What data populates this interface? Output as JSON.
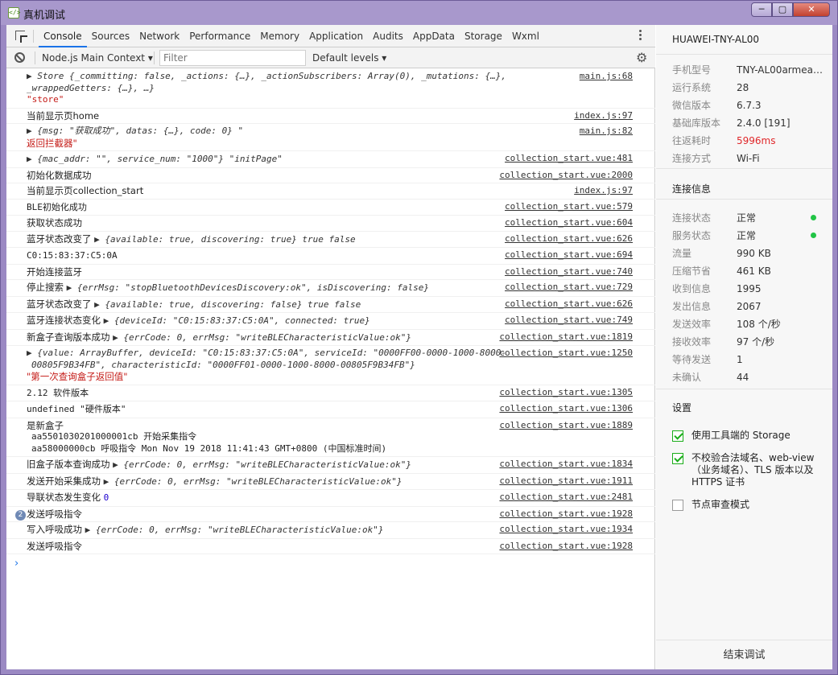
{
  "window": {
    "title": "真机调试",
    "app_icon": "</>",
    "minimize": "─",
    "maximize": "▢",
    "close": "✕"
  },
  "devtools": {
    "tabs": [
      {
        "label": "Console",
        "active": true
      },
      {
        "label": "Sources"
      },
      {
        "label": "Network"
      },
      {
        "label": "Performance"
      },
      {
        "label": "Memory"
      },
      {
        "label": "Application"
      },
      {
        "label": "Audits"
      },
      {
        "label": "AppData"
      },
      {
        "label": "Storage"
      },
      {
        "label": "Wxml"
      }
    ],
    "toolbar": {
      "context": "Node.js Main Context",
      "filter_placeholder": "Filter",
      "levels": "Default levels"
    }
  },
  "console": {
    "rows": [
      {
        "src": "main.js:68",
        "line1": "▶ Store {_committing: false, _actions: {…}, _actionSubscribers: Array(0), _mutations: {…}, _wrappedGetters: {…}, …}",
        "line2": "\"store\""
      },
      {
        "src": "index.js:97",
        "text": "当前显示页home"
      },
      {
        "src": "main.js:82",
        "line1": "▶ {msg: \"获取成功\", datas: {…}, code: 0} \"",
        "line2": "返回拦截器\""
      },
      {
        "src": "collection_start.vue:481",
        "text": "▶ {mac_addr: \"\", service_num: \"1000\"} \"initPage\""
      },
      {
        "src": "collection_start.vue:2000",
        "text": "初始化数据成功"
      },
      {
        "src": "index.js:97",
        "text": "当前显示页collection_start"
      },
      {
        "src": "collection_start.vue:579",
        "text": "BLE初始化成功"
      },
      {
        "src": "collection_start.vue:604",
        "text": "获取状态成功"
      },
      {
        "src": "collection_start.vue:626",
        "prefix": "蓝牙状态改变了 ",
        "text": "▶ {available: true, discovering: true} true false"
      },
      {
        "src": "collection_start.vue:694",
        "text": "C0:15:83:37:C5:0A"
      },
      {
        "src": "collection_start.vue:740",
        "text": "开始连接蓝牙"
      },
      {
        "src": "collection_start.vue:729",
        "prefix": "停止搜索 ",
        "text": "▶ {errMsg: \"stopBluetoothDevicesDiscovery:ok\", isDiscovering: false}"
      },
      {
        "src": "collection_start.vue:626",
        "prefix": "蓝牙状态改变了 ",
        "text": "▶ {available: true, discovering: false} true false"
      },
      {
        "src": "collection_start.vue:749",
        "prefix": "蓝牙连接状态变化 ",
        "text": "▶ {deviceId: \"C0:15:83:37:C5:0A\", connected: true}"
      },
      {
        "src": "collection_start.vue:1819",
        "prefix": "新盒子查询版本成功 ",
        "text": "▶ {errCode: 0, errMsg: \"writeBLECharacteristicValue:ok\"}"
      },
      {
        "src": "collection_start.vue:1250",
        "line1": "▶ {value: ArrayBuffer, deviceId: \"C0:15:83:37:C5:0A\", serviceId: \"0000FF00-0000-1000-8000-",
        "line2": "00805F9B34FB\", characteristicId: \"0000FF01-0000-1000-8000-00805F9B34FB\"}",
        "line3": "\"第一次查询盒子返回值\""
      },
      {
        "src": "collection_start.vue:1305",
        "text": "2.12 软件版本"
      },
      {
        "src": "collection_start.vue:1306",
        "text": "undefined \"硬件版本\""
      },
      {
        "src": "collection_start.vue:1889",
        "line1": "是新盒子",
        "line2": "aa5501030201000001cb 开始采集指令",
        "line3": "aa58000000cb 呼吸指令 Mon Nov 19 2018 11:41:43 GMT+0800 (中国标准时间)"
      },
      {
        "src": "collection_start.vue:1834",
        "prefix": "旧盒子版本查询成功 ",
        "text": "▶ {errCode: 0, errMsg: \"writeBLECharacteristicValue:ok\"}"
      },
      {
        "src": "collection_start.vue:1911",
        "prefix": "发送开始采集成功 ",
        "text": "▶ {errCode: 0, errMsg: \"writeBLECharacteristicValue:ok\"}"
      },
      {
        "src": "collection_start.vue:2481",
        "prefix": "导联状态发生变化 ",
        "text": "0"
      },
      {
        "src": "collection_start.vue:1928",
        "badge": "2",
        "text": "发送呼吸指令"
      },
      {
        "src": "collection_start.vue:1934",
        "prefix": "写入呼吸成功 ",
        "text": "▶ {errCode: 0, errMsg: \"writeBLECharacteristicValue:ok\"}"
      },
      {
        "src": "collection_start.vue:1928",
        "text": "发送呼吸指令"
      }
    ],
    "prompt": "›"
  },
  "panel": {
    "device_name": "HUAWEI-TNY-AL00",
    "device_info": [
      {
        "label": "手机型号",
        "value": "TNY-AL00armea…"
      },
      {
        "label": "运行系统",
        "value": "28"
      },
      {
        "label": "微信版本",
        "value": "6.7.3"
      },
      {
        "label": "基础库版本",
        "value": "2.4.0 [191]"
      },
      {
        "label": "往返耗时",
        "value": "5996ms",
        "highlight_color": "#e0272a"
      },
      {
        "label": "连接方式",
        "value": "Wi-Fi"
      }
    ],
    "connection_title": "连接信息",
    "connection_info": [
      {
        "label": "连接状态",
        "value": "正常",
        "status_color": "#21c445"
      },
      {
        "label": "服务状态",
        "value": "正常",
        "status_color": "#21c445"
      },
      {
        "label": "流量",
        "value": "990 KB"
      },
      {
        "label": "压缩节省",
        "value": "461 KB"
      },
      {
        "label": "收到信息",
        "value": "1995"
      },
      {
        "label": "发出信息",
        "value": "2067"
      },
      {
        "label": "发送效率",
        "value": "108 个/秒"
      },
      {
        "label": "接收效率",
        "value": "97 个/秒"
      },
      {
        "label": "等待发送",
        "value": "1"
      },
      {
        "label": "未确认",
        "value": "44"
      }
    ],
    "settings_title": "设置",
    "settings": [
      {
        "label": "使用工具端的 Storage",
        "checked": true
      },
      {
        "label": "不校验合法域名、web-view（业务域名）、TLS 版本以及 HTTPS 证书",
        "checked": true
      },
      {
        "label": "节点审查模式",
        "checked": false
      }
    ],
    "end_button": "结束调试"
  }
}
